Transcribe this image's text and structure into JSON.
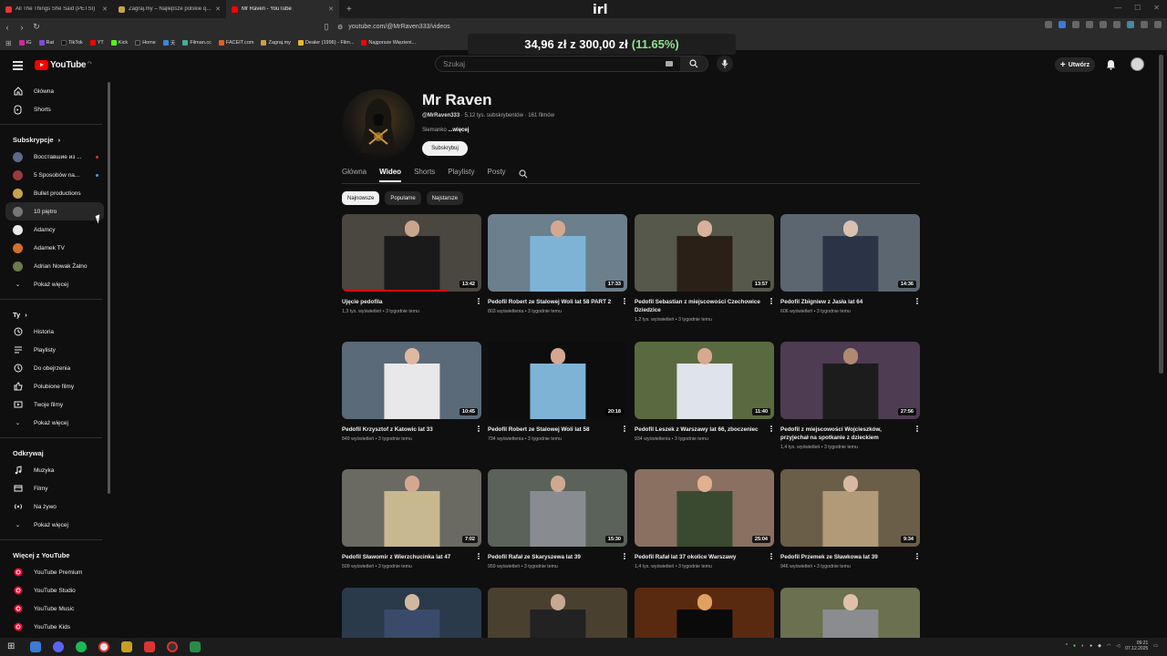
{
  "browser": {
    "tabs": [
      {
        "title": "All The Things She Said (PETSI)",
        "active": false
      },
      {
        "title": "Zagraj.my – Najlepsze polskie quizy",
        "active": false
      },
      {
        "title": "Mr Raven - YouTube",
        "active": true
      }
    ],
    "overlay_logo": "irl",
    "url": "youtube.com/@MrRaven333/videos",
    "bookmarks": [
      "IG",
      "Rat",
      "TikTok",
      "YT",
      "Kick",
      "Home",
      "天",
      "Filman.cc",
      "FACEIT.com",
      "Zagraj.my",
      "Dealer (1996) - Film...",
      "Najgorsze Więzieni..."
    ]
  },
  "donation": {
    "amount": "34,96 zł",
    "sep": "z",
    "goal": "300,00 zł",
    "percent": "(11.65%)"
  },
  "header": {
    "logo_text": "YouTube",
    "logo_region": "PL",
    "search_placeholder": "Szukaj",
    "create_label": "Utwórz"
  },
  "sidebar": {
    "main": [
      {
        "label": "Główna",
        "icon": "home-icon"
      },
      {
        "label": "Shorts",
        "icon": "shorts-icon"
      }
    ],
    "subs_heading": "Subskrypcje",
    "subscriptions": [
      {
        "label": "Восставшие из ...",
        "color": "#5b6a8a",
        "dot": "#d33"
      },
      {
        "label": "5 Sposobów na...",
        "color": "#9b3a3a",
        "dot": "#3ea6ff"
      },
      {
        "label": "Bullet productions",
        "color": "#c8a24a",
        "dot": ""
      },
      {
        "label": "10 piętro",
        "color": "#777",
        "dot": ""
      },
      {
        "label": "Adamcy",
        "color": "#e8e8e8",
        "dot": ""
      },
      {
        "label": "Adamek TV",
        "color": "#d0702a",
        "dot": ""
      },
      {
        "label": "Adrian Nowak Żalno",
        "color": "#6a7a4a",
        "dot": ""
      }
    ],
    "show_more": "Pokaż więcej",
    "you_heading": "Ty",
    "you_items": [
      {
        "label": "Historia",
        "icon": "history-icon"
      },
      {
        "label": "Playlisty",
        "icon": "playlist-icon"
      },
      {
        "label": "Do obejrzenia",
        "icon": "watch-later-icon"
      },
      {
        "label": "Polubione filmy",
        "icon": "like-icon"
      },
      {
        "label": "Twoje filmy",
        "icon": "your-videos-icon"
      }
    ],
    "explore_heading": "Odkrywaj",
    "explore_items": [
      {
        "label": "Muzyka",
        "icon": "music-icon"
      },
      {
        "label": "Filmy",
        "icon": "movies-icon"
      },
      {
        "label": "Na żywo",
        "icon": "live-icon"
      }
    ],
    "more_heading": "Więcej z YouTube",
    "more_items": [
      {
        "label": "YouTube Premium"
      },
      {
        "label": "YouTube Studio"
      },
      {
        "label": "YouTube Music"
      },
      {
        "label": "YouTube Kids"
      }
    ]
  },
  "channel": {
    "name": "Mr Raven",
    "handle": "@MrRaven333",
    "subs": "5,12 tys. subskrybentów",
    "videos": "161 filmów",
    "desc": "Siemanko",
    "more": "...więcej",
    "subscribe": "Subskrybuj",
    "tabs": [
      "Główna",
      "Wideo",
      "Shorts",
      "Playlisty",
      "Posty"
    ],
    "active_tab": 1,
    "chips": [
      "Najnowsze",
      "Popularne",
      "Najstarsze"
    ]
  },
  "videos": [
    {
      "title": "Ujęcie pedofila",
      "views": "1,3 tys. wyświetleń",
      "age": "3 tygodnie temu",
      "dur": "13:42",
      "bg": "#4a4640",
      "fig": "#1a1a1a",
      "head": "#c9a58c",
      "progress": 0.75
    },
    {
      "title": "Pedofil Robert ze Stalowej Woli lat 58 PART 2",
      "views": "803 wyświetlenia",
      "age": "3 tygodnie temu",
      "dur": "17:33",
      "bg": "#6b7f8c",
      "fig": "#7fb3d6",
      "head": "#d4a890",
      "progress": 0
    },
    {
      "title": "Pedofil Sebastian z miejscowości Czechowice Dziedzice",
      "views": "1,2 tys. wyświetleń",
      "age": "3 tygodnie temu",
      "dur": "13:57",
      "bg": "#55584a",
      "fig": "#2a2018",
      "head": "#d9b19a",
      "progress": 0
    },
    {
      "title": "Pedofil Zbigniew z Jasła lat 64",
      "views": "606 wyświetleń",
      "age": "3 tygodnie temu",
      "dur": "14:36",
      "bg": "#5c6670",
      "fig": "#2a3446",
      "head": "#d8c1b0",
      "progress": 0
    },
    {
      "title": "Pedofil Krzysztof z Katowic lat 33",
      "views": "849 wyświetleń",
      "age": "3 tygodnie temu",
      "dur": "10:45",
      "bg": "#5a6a78",
      "fig": "#e8e8ea",
      "head": "#e0b8a0",
      "progress": 0
    },
    {
      "title": "Pedofil Robert ze Stalowej Woli lat 58",
      "views": "734 wyświetlenia",
      "age": "3 tygodnie temu",
      "dur": "20:18",
      "bg": "#0d0d0d",
      "fig": "#7fb3d6",
      "head": "#d4a890",
      "progress": 0
    },
    {
      "title": "Pedofil Leszek z Warszawy lat 66, zboczeniec",
      "views": "934 wyświetlenia",
      "age": "3 tygodnie temu",
      "dur": "11:40",
      "bg": "#5a6a40",
      "fig": "#dfe3ea",
      "head": "#d8a890",
      "progress": 0
    },
    {
      "title": "Pedofil z miejscowości Wojcieszków, przyjechał na spotkanie z dzieckiem",
      "views": "1,4 tys. wyświetleń",
      "age": "3 tygodnie temu",
      "dur": "27:56",
      "bg": "#4e3c52",
      "fig": "#1c1c1c",
      "head": "#b08a70",
      "progress": 0
    },
    {
      "title": "Pedofil Sławomir z Wierzchucinka lat 47",
      "views": "509 wyświetleń",
      "age": "3 tygodnie temu",
      "dur": "7:02",
      "bg": "#6a6a62",
      "fig": "#c8b890",
      "head": "#d4a890",
      "progress": 0
    },
    {
      "title": "Pedofil Rafał ze Skaryszewa lat 39",
      "views": "959 wyświetleń",
      "age": "3 tygodnie temu",
      "dur": "15:30",
      "bg": "#5a625a",
      "fig": "#888c90",
      "head": "#d0a890",
      "progress": 0
    },
    {
      "title": "Pedofil Rafał lat 37 okolice Warszawy",
      "views": "1,4 tys. wyświetleń",
      "age": "3 tygodnie temu",
      "dur": "25:04",
      "bg": "#8a7060",
      "fig": "#3a4a30",
      "head": "#e0b090",
      "progress": 0
    },
    {
      "title": "Pedofil Przemek ze Sławkowa lat 39",
      "views": "946 wyświetleń",
      "age": "3 tygodnie temu",
      "dur": "9:34",
      "bg": "#6a5e48",
      "fig": "#b09a78",
      "head": "#d8b8a0",
      "progress": 0
    },
    {
      "title": "",
      "views": "",
      "age": "",
      "dur": "",
      "bg": "#2a3a4a",
      "fig": "#3a4a6a",
      "head": "#d0b8a0",
      "progress": 0
    },
    {
      "title": "",
      "views": "",
      "age": "",
      "dur": "",
      "bg": "#4a4030",
      "fig": "#222",
      "head": "#c8a890",
      "progress": 0
    },
    {
      "title": "",
      "views": "",
      "age": "",
      "dur": "",
      "bg": "#5a2a10",
      "fig": "#0a0a0a",
      "head": "#e0a060",
      "progress": 0
    },
    {
      "title": "",
      "views": "",
      "age": "",
      "dur": "",
      "bg": "#6a7050",
      "fig": "#8a8c90",
      "head": "#e0c0a8",
      "progress": 0
    }
  ],
  "taskbar": {
    "time": "09:21",
    "date": "07.12.2025"
  }
}
